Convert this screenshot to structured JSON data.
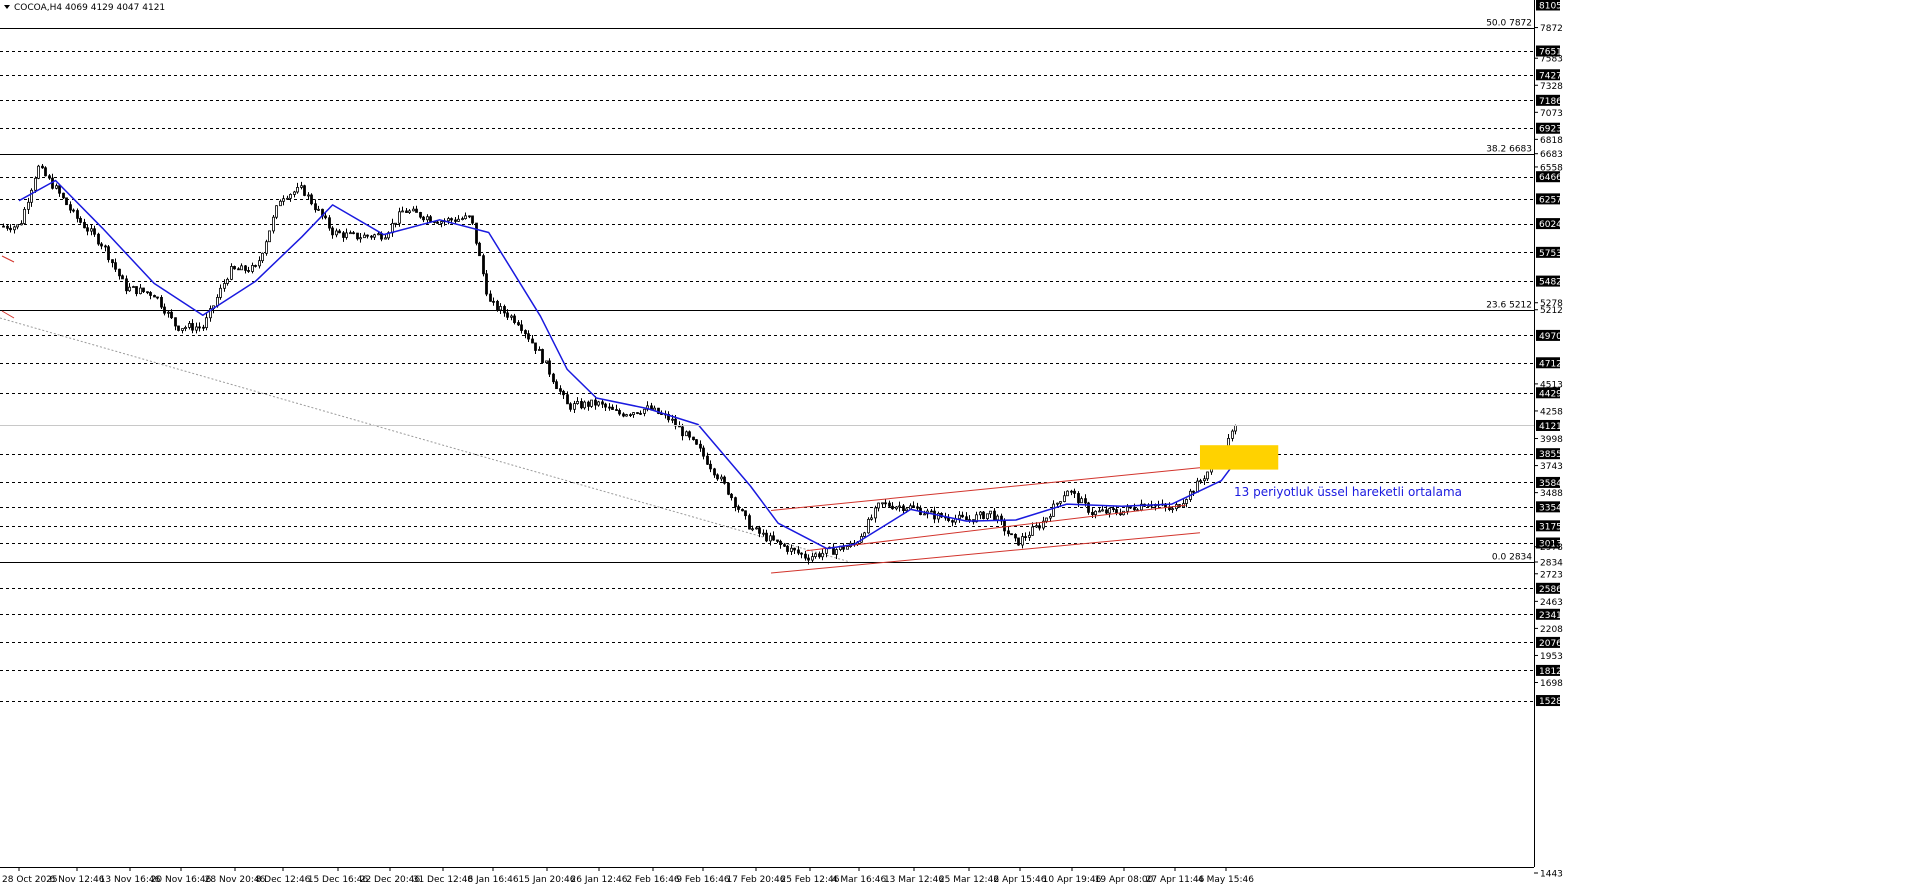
{
  "header": {
    "title": "COCOA,H4  4069 4129 4047 4121"
  },
  "colors": {
    "candle": "#000000",
    "ema": "#1a1adf",
    "channel": "#d2342c",
    "highlight": "#ffd200",
    "annotation": "#1a1adf",
    "grid": "#000000",
    "axis": "#000000"
  },
  "chart_data": {
    "type": "candlestick",
    "symbol": "COCOA",
    "timeframe": "H4",
    "ylim": [
      1443,
      8105
    ],
    "y_tick_labels": [
      8105,
      7872,
      7651,
      7583,
      7427,
      7328,
      7186,
      7073,
      6923,
      6818,
      6683,
      6558,
      6466,
      6257,
      6024,
      5753,
      5482,
      5278,
      5212,
      4970,
      4712,
      4513,
      4429,
      4258,
      4121,
      3998,
      3855,
      3743,
      3584,
      3488,
      3354,
      3175,
      3013,
      2978,
      2834,
      2723,
      2586,
      2463,
      2341,
      2208,
      2076,
      1953,
      1812,
      1698,
      1528,
      1443
    ],
    "x_tick_labels": [
      "28 Oct 2025",
      "6 Nov 12:46",
      "13 Nov 16:46",
      "20 Nov 16:46",
      "28 Nov 20:46",
      "8 Dec 12:46",
      "15 Dec 16:46",
      "22 Dec 20:46",
      "31 Dec 12:46",
      "8 Jan 16:46",
      "15 Jan 20:46",
      "26 Jan 12:46",
      "2 Feb 16:46",
      "9 Feb 16:46",
      "17 Feb 20:46",
      "25 Feb 12:46",
      "4 Mar 16:46",
      "13 Mar 12:46",
      "25 Mar 12:46",
      "2 Apr 15:46",
      "10 Apr 19:46",
      "19 Apr 08:00",
      "27 Apr 11:46",
      "4 May 15:46"
    ],
    "price_levels": [
      7651,
      7427,
      7186,
      6923,
      6466,
      6257,
      6024,
      5753,
      5482,
      4970,
      4712,
      4429,
      3855,
      3584,
      3354,
      3175,
      3013,
      2586,
      2341,
      2076,
      1812,
      1528
    ],
    "fibonacci": [
      {
        "label": "50.0 7872",
        "value": 7872
      },
      {
        "label": "38.2 6683",
        "value": 6683
      },
      {
        "label": "23.6 5212",
        "value": 5212
      },
      {
        "label": "0.0 2834",
        "value": 2834
      }
    ],
    "current_price": 4121,
    "last_bar": {
      "open": 4069,
      "high": 4129,
      "low": 4047,
      "close": 4121
    },
    "close_path": [
      {
        "date": "28 Oct 2025",
        "close": 6000
      },
      {
        "date": "31 Oct 2025",
        "close": 6560
      },
      {
        "date": "3 Nov 2025",
        "close": 6350
      },
      {
        "date": "6 Nov 2025",
        "close": 6100
      },
      {
        "date": "10 Nov 2025",
        "close": 5820
      },
      {
        "date": "13 Nov 2025",
        "close": 5420
      },
      {
        "date": "17 Nov 2025",
        "close": 5360
      },
      {
        "date": "20 Nov 2025",
        "close": 5050
      },
      {
        "date": "24 Nov 2025",
        "close": 5050
      },
      {
        "date": "28 Nov 2025",
        "close": 5580
      },
      {
        "date": "3 Dec 2025",
        "close": 5600
      },
      {
        "date": "8 Dec 2025",
        "close": 6280
      },
      {
        "date": "11 Dec 2025",
        "close": 6350
      },
      {
        "date": "15 Dec 2025",
        "close": 5940
      },
      {
        "date": "18 Dec 2025",
        "close": 5900
      },
      {
        "date": "22 Dec 2025",
        "close": 5920
      },
      {
        "date": "25 Dec 2025",
        "close": 6150
      },
      {
        "date": "31 Dec 2025",
        "close": 6050
      },
      {
        "date": "5 Jan 2026",
        "close": 6080
      },
      {
        "date": "8 Jan 2026",
        "close": 5280
      },
      {
        "date": "12 Jan 2026",
        "close": 5100
      },
      {
        "date": "15 Jan 2026",
        "close": 4780
      },
      {
        "date": "20 Jan 2026",
        "close": 4300
      },
      {
        "date": "26 Jan 2026",
        "close": 4330
      },
      {
        "date": "29 Jan 2026",
        "close": 4230
      },
      {
        "date": "2 Feb 2026",
        "close": 4280
      },
      {
        "date": "5 Feb 2026",
        "close": 4180
      },
      {
        "date": "9 Feb 2026",
        "close": 3900
      },
      {
        "date": "13 Feb 2026",
        "close": 3550
      },
      {
        "date": "17 Feb 2026",
        "close": 3150
      },
      {
        "date": "21 Feb 2026",
        "close": 3000
      },
      {
        "date": "25 Feb 2026",
        "close": 2880
      },
      {
        "date": "28 Feb 2026",
        "close": 2930
      },
      {
        "date": "4 Mar 2026",
        "close": 3000
      },
      {
        "date": "8 Mar 2026",
        "close": 3380
      },
      {
        "date": "13 Mar 2026",
        "close": 3350
      },
      {
        "date": "18 Mar 2026",
        "close": 3270
      },
      {
        "date": "25 Mar 2026",
        "close": 3230
      },
      {
        "date": "29 Mar 2026",
        "close": 3300
      },
      {
        "date": "2 Apr 2026",
        "close": 3010
      },
      {
        "date": "6 Apr 2026",
        "close": 3200
      },
      {
        "date": "10 Apr 2026",
        "close": 3520
      },
      {
        "date": "14 Apr 2026",
        "close": 3300
      },
      {
        "date": "19 Apr 2026",
        "close": 3310
      },
      {
        "date": "23 Apr 2026",
        "close": 3400
      },
      {
        "date": "27 Apr 2026",
        "close": 3320
      },
      {
        "date": "30 Apr 2026",
        "close": 3520
      },
      {
        "date": "4 May 2026",
        "close": 3850
      },
      {
        "date": "6 May 2026",
        "close": 4121
      }
    ],
    "ema": {
      "period": 13,
      "label": "13 periyotluk üssel hareketli ortalama",
      "points": [
        {
          "date": "28 Oct 2025",
          "value": 6240
        },
        {
          "date": "3 Nov 2025",
          "value": 6430
        },
        {
          "date": "10 Nov 2025",
          "value": 5980
        },
        {
          "date": "17 Nov 2025",
          "value": 5460
        },
        {
          "date": "24 Nov 2025",
          "value": 5160
        },
        {
          "date": "3 Dec 2025",
          "value": 5480
        },
        {
          "date": "11 Dec 2025",
          "value": 5900
        },
        {
          "date": "15 Dec 2025",
          "value": 6200
        },
        {
          "date": "22 Dec 2025",
          "value": 5920
        },
        {
          "date": "31 Dec 2025",
          "value": 6060
        },
        {
          "date": "8 Jan 2026",
          "value": 5940
        },
        {
          "date": "15 Jan 2026",
          "value": 5150
        },
        {
          "date": "20 Jan 2026",
          "value": 4650
        },
        {
          "date": "26 Jan 2026",
          "value": 4380
        },
        {
          "date": "2 Feb 2026",
          "value": 4280
        },
        {
          "date": "9 Feb 2026",
          "value": 4130
        },
        {
          "date": "17 Feb 2026",
          "value": 3550
        },
        {
          "date": "21 Feb 2026",
          "value": 3200
        },
        {
          "date": "28 Feb 2026",
          "value": 2960
        },
        {
          "date": "4 Mar 2026",
          "value": 3000
        },
        {
          "date": "13 Mar 2026",
          "value": 3330
        },
        {
          "date": "25 Mar 2026",
          "value": 3220
        },
        {
          "date": "2 Apr 2026",
          "value": 3230
        },
        {
          "date": "10 Apr 2026",
          "value": 3380
        },
        {
          "date": "19 Apr 2026",
          "value": 3360
        },
        {
          "date": "27 Apr 2026",
          "value": 3380
        },
        {
          "date": "4 May 2026",
          "value": 3600
        },
        {
          "date": "6 May 2026",
          "value": 3780
        }
      ]
    },
    "channel": {
      "upper": [
        {
          "date": "20 Feb 2026",
          "value": 3320
        },
        {
          "date": "2 May 2026",
          "value": 3730
        }
      ],
      "middle": [
        {
          "date": "25 Feb 2026",
          "value": 2940
        },
        {
          "date": "29 Apr 2026",
          "value": 3370
        }
      ],
      "lower": [
        {
          "date": "20 Feb 2026",
          "value": 2730
        },
        {
          "date": "1 May 2026",
          "value": 3110
        }
      ]
    },
    "resistance_zone": {
      "from_date": "1 May 2026",
      "to_date": "12 May 2026",
      "low": 3705,
      "high": 3935
    },
    "grid": "horizontal dashed price levels",
    "legend": "none"
  }
}
